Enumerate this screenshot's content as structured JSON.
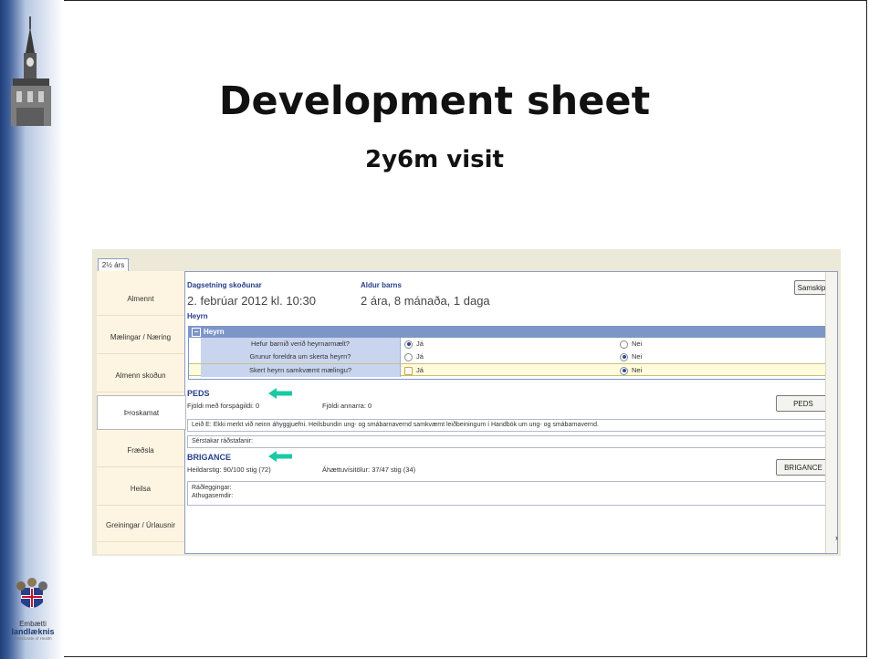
{
  "slide": {
    "title": "Development sheet",
    "subtitle": "2y6m visit",
    "org": {
      "line1": "Embætti",
      "line2": "landlæknis",
      "line3": "Directorate of Health"
    }
  },
  "app": {
    "tab_label": "2½ árs",
    "nav_items": [
      {
        "label": "Almennt"
      },
      {
        "label": "Mælingar / Næring"
      },
      {
        "label": "Almenn skoðun"
      },
      {
        "label": "Þroskamat",
        "active": true
      },
      {
        "label": "Fræðsla"
      },
      {
        "label": "Heilsa"
      },
      {
        "label": "Greiningar / Úrlausnir"
      }
    ],
    "header": {
      "date_label": "Dagsetning skoðunar",
      "date_value": "2. febrúar 2012 kl. 10:30",
      "age_label": "Aldur barns",
      "age_value": "2 ára, 8 mánaða, 1 daga",
      "button": "Samskipti"
    },
    "hearing": {
      "section_label": "Heyrn",
      "group_label": "Heyrn",
      "rows": [
        {
          "question": "Hefur barnið verið heyrnarmælt?",
          "yes": "Já",
          "no": "Nei",
          "selected": "yes"
        },
        {
          "question": "Grunur foreldra um skerta heyrn?",
          "yes": "Já",
          "no": "Nei",
          "selected": "no"
        },
        {
          "question": "Skert heyrn samkvæmt mælingu?",
          "yes": "Já",
          "no": "Nei",
          "selected": "no"
        }
      ]
    },
    "peds": {
      "label": "PEDS",
      "count_predictive": "Fjöldi með forspágildi: 0",
      "count_other": "Fjöldi annarra: 0",
      "button": "PEDS",
      "result": "Leið E: Ekki merkt við neinn áhyggjuefni. Heilsbundin ung- og smábarnavernd samkvæmt leiðbeiningum í Handbók um ung- og smábarnavernd.",
      "special": "Sérstakar ráðstafanir:"
    },
    "brigance": {
      "label": "BRIGANCE",
      "total": "Heildarstig: 90/100 stig (72)",
      "risk": "Áhættuvísitölur: 37/47 stig (34)",
      "button": "BRIGANCE",
      "advice": "Ráðleggingar:",
      "notes": "Athugasemdir:"
    }
  },
  "colors": {
    "hearing_header": "#7d96c8",
    "question_cell": "#c9d5ef",
    "nav_bg": "#fdf5e1",
    "annotation_arrow": "#19c9a4"
  }
}
